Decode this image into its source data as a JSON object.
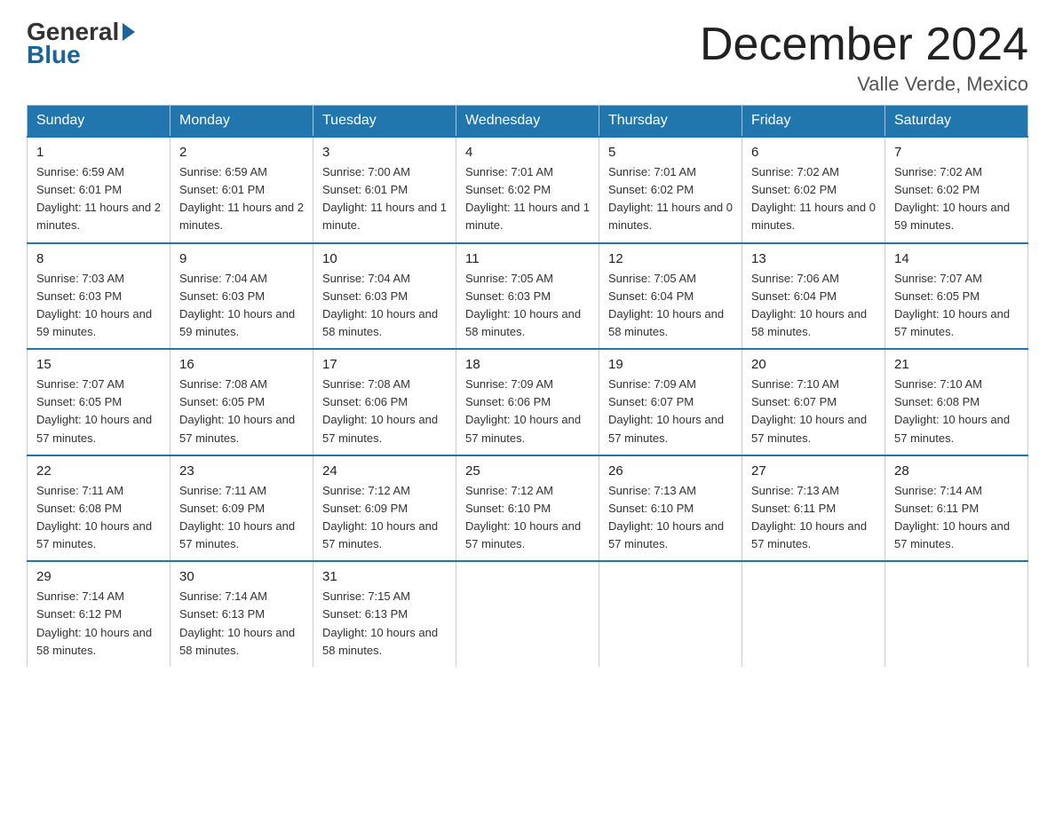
{
  "header": {
    "logo_general": "General",
    "logo_blue": "Blue",
    "month_title": "December 2024",
    "location": "Valle Verde, Mexico"
  },
  "days_of_week": [
    "Sunday",
    "Monday",
    "Tuesday",
    "Wednesday",
    "Thursday",
    "Friday",
    "Saturday"
  ],
  "weeks": [
    [
      {
        "day": "1",
        "sunrise": "6:59 AM",
        "sunset": "6:01 PM",
        "daylight": "11 hours and 2 minutes."
      },
      {
        "day": "2",
        "sunrise": "6:59 AM",
        "sunset": "6:01 PM",
        "daylight": "11 hours and 2 minutes."
      },
      {
        "day": "3",
        "sunrise": "7:00 AM",
        "sunset": "6:01 PM",
        "daylight": "11 hours and 1 minute."
      },
      {
        "day": "4",
        "sunrise": "7:01 AM",
        "sunset": "6:02 PM",
        "daylight": "11 hours and 1 minute."
      },
      {
        "day": "5",
        "sunrise": "7:01 AM",
        "sunset": "6:02 PM",
        "daylight": "11 hours and 0 minutes."
      },
      {
        "day": "6",
        "sunrise": "7:02 AM",
        "sunset": "6:02 PM",
        "daylight": "11 hours and 0 minutes."
      },
      {
        "day": "7",
        "sunrise": "7:02 AM",
        "sunset": "6:02 PM",
        "daylight": "10 hours and 59 minutes."
      }
    ],
    [
      {
        "day": "8",
        "sunrise": "7:03 AM",
        "sunset": "6:03 PM",
        "daylight": "10 hours and 59 minutes."
      },
      {
        "day": "9",
        "sunrise": "7:04 AM",
        "sunset": "6:03 PM",
        "daylight": "10 hours and 59 minutes."
      },
      {
        "day": "10",
        "sunrise": "7:04 AM",
        "sunset": "6:03 PM",
        "daylight": "10 hours and 58 minutes."
      },
      {
        "day": "11",
        "sunrise": "7:05 AM",
        "sunset": "6:03 PM",
        "daylight": "10 hours and 58 minutes."
      },
      {
        "day": "12",
        "sunrise": "7:05 AM",
        "sunset": "6:04 PM",
        "daylight": "10 hours and 58 minutes."
      },
      {
        "day": "13",
        "sunrise": "7:06 AM",
        "sunset": "6:04 PM",
        "daylight": "10 hours and 58 minutes."
      },
      {
        "day": "14",
        "sunrise": "7:07 AM",
        "sunset": "6:05 PM",
        "daylight": "10 hours and 57 minutes."
      }
    ],
    [
      {
        "day": "15",
        "sunrise": "7:07 AM",
        "sunset": "6:05 PM",
        "daylight": "10 hours and 57 minutes."
      },
      {
        "day": "16",
        "sunrise": "7:08 AM",
        "sunset": "6:05 PM",
        "daylight": "10 hours and 57 minutes."
      },
      {
        "day": "17",
        "sunrise": "7:08 AM",
        "sunset": "6:06 PM",
        "daylight": "10 hours and 57 minutes."
      },
      {
        "day": "18",
        "sunrise": "7:09 AM",
        "sunset": "6:06 PM",
        "daylight": "10 hours and 57 minutes."
      },
      {
        "day": "19",
        "sunrise": "7:09 AM",
        "sunset": "6:07 PM",
        "daylight": "10 hours and 57 minutes."
      },
      {
        "day": "20",
        "sunrise": "7:10 AM",
        "sunset": "6:07 PM",
        "daylight": "10 hours and 57 minutes."
      },
      {
        "day": "21",
        "sunrise": "7:10 AM",
        "sunset": "6:08 PM",
        "daylight": "10 hours and 57 minutes."
      }
    ],
    [
      {
        "day": "22",
        "sunrise": "7:11 AM",
        "sunset": "6:08 PM",
        "daylight": "10 hours and 57 minutes."
      },
      {
        "day": "23",
        "sunrise": "7:11 AM",
        "sunset": "6:09 PM",
        "daylight": "10 hours and 57 minutes."
      },
      {
        "day": "24",
        "sunrise": "7:12 AM",
        "sunset": "6:09 PM",
        "daylight": "10 hours and 57 minutes."
      },
      {
        "day": "25",
        "sunrise": "7:12 AM",
        "sunset": "6:10 PM",
        "daylight": "10 hours and 57 minutes."
      },
      {
        "day": "26",
        "sunrise": "7:13 AM",
        "sunset": "6:10 PM",
        "daylight": "10 hours and 57 minutes."
      },
      {
        "day": "27",
        "sunrise": "7:13 AM",
        "sunset": "6:11 PM",
        "daylight": "10 hours and 57 minutes."
      },
      {
        "day": "28",
        "sunrise": "7:14 AM",
        "sunset": "6:11 PM",
        "daylight": "10 hours and 57 minutes."
      }
    ],
    [
      {
        "day": "29",
        "sunrise": "7:14 AM",
        "sunset": "6:12 PM",
        "daylight": "10 hours and 58 minutes."
      },
      {
        "day": "30",
        "sunrise": "7:14 AM",
        "sunset": "6:13 PM",
        "daylight": "10 hours and 58 minutes."
      },
      {
        "day": "31",
        "sunrise": "7:15 AM",
        "sunset": "6:13 PM",
        "daylight": "10 hours and 58 minutes."
      },
      null,
      null,
      null,
      null
    ]
  ],
  "labels": {
    "sunrise": "Sunrise:",
    "sunset": "Sunset:",
    "daylight": "Daylight:"
  }
}
